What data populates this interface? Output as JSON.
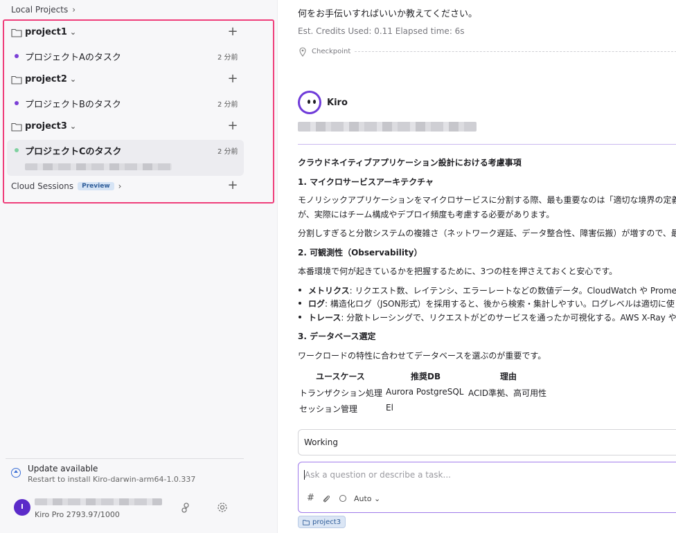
{
  "sidebar": {
    "local_projects_label": "Local Projects",
    "projects": [
      {
        "name": "project1",
        "task": "プロジェクトAのタスク",
        "task_time": "2 分前",
        "dot_color": "#7b3fd6"
      },
      {
        "name": "project2",
        "task": "プロジェクトBのタスク",
        "task_time": "2 分前",
        "dot_color": "#7b3fd6"
      },
      {
        "name": "project3",
        "task": "プロジェクトCのタスク",
        "task_time": "2 分前",
        "dot_color": "#7fd1a0"
      }
    ],
    "cloud_sessions_label": "Cloud Sessions",
    "preview_badge": "Preview",
    "update_title": "Update available",
    "update_subtitle": "Restart to install Kiro-darwin-arm64-1.0.337",
    "avatar_initial": "I",
    "plan_text": "Kiro Pro 2793.97/1000"
  },
  "chat": {
    "prev_message": "何をお手伝いすればいいか教えてください。",
    "stats": "Est. Credits Used: 0.11   Elapsed time: 6s",
    "checkpoint_label": "Checkpoint",
    "assistant_name": "Kiro",
    "title": "クラウドネイティブアプリケーション設計における考慮事項",
    "section1_heading": "1. マイクロサービスアーキテクチャ",
    "section1_p1_line1": "モノリシックアプリケーションをマイクロサービスに分割する際、最も重要なのは「適切な境界の定義",
    "section1_p1_line2": "が、実際にはチーム構成やデプロイ頻度も考慮する必要があります。",
    "section1_p2": "分割しすぎると分散システムの複雑さ（ネットワーク遅延、データ整合性、障害伝搬）が増すので、最",
    "section2_heading": "2. 可観測性（Observability）",
    "section2_intro": "本番環境で何が起きているかを把握するために、3つの柱を押さえておくと安心です。",
    "bullets": [
      {
        "term": "メトリクス",
        "text": ": リクエスト数、レイテンシ、エラーレートなどの数値データ。CloudWatch や Prome"
      },
      {
        "term": "ログ",
        "text": ": 構造化ログ（JSON形式）を採用すると、後から検索・集計しやすい。ログレベルは適切に使"
      },
      {
        "term": "トレース",
        "text": ": 分散トレーシングで、リクエストがどのサービスを通ったか可視化する。AWS X-Ray や"
      }
    ],
    "section3_heading": "3. データベース選定",
    "section3_intro": "ワークロードの特性に合わせてデータベースを選ぶのが重要です。",
    "table": {
      "headers": [
        "ユースケース",
        "推奨DB",
        "理由"
      ],
      "rows": [
        [
          "トランザクション処理",
          "Aurora PostgreSQL",
          "ACID準拠、高可用性"
        ],
        [
          "セッション管理",
          "El",
          ""
        ]
      ]
    },
    "working_label": "Working",
    "input_placeholder": "Ask a question or describe a task...",
    "mode_label": "Auto",
    "context_chip": "project3"
  }
}
